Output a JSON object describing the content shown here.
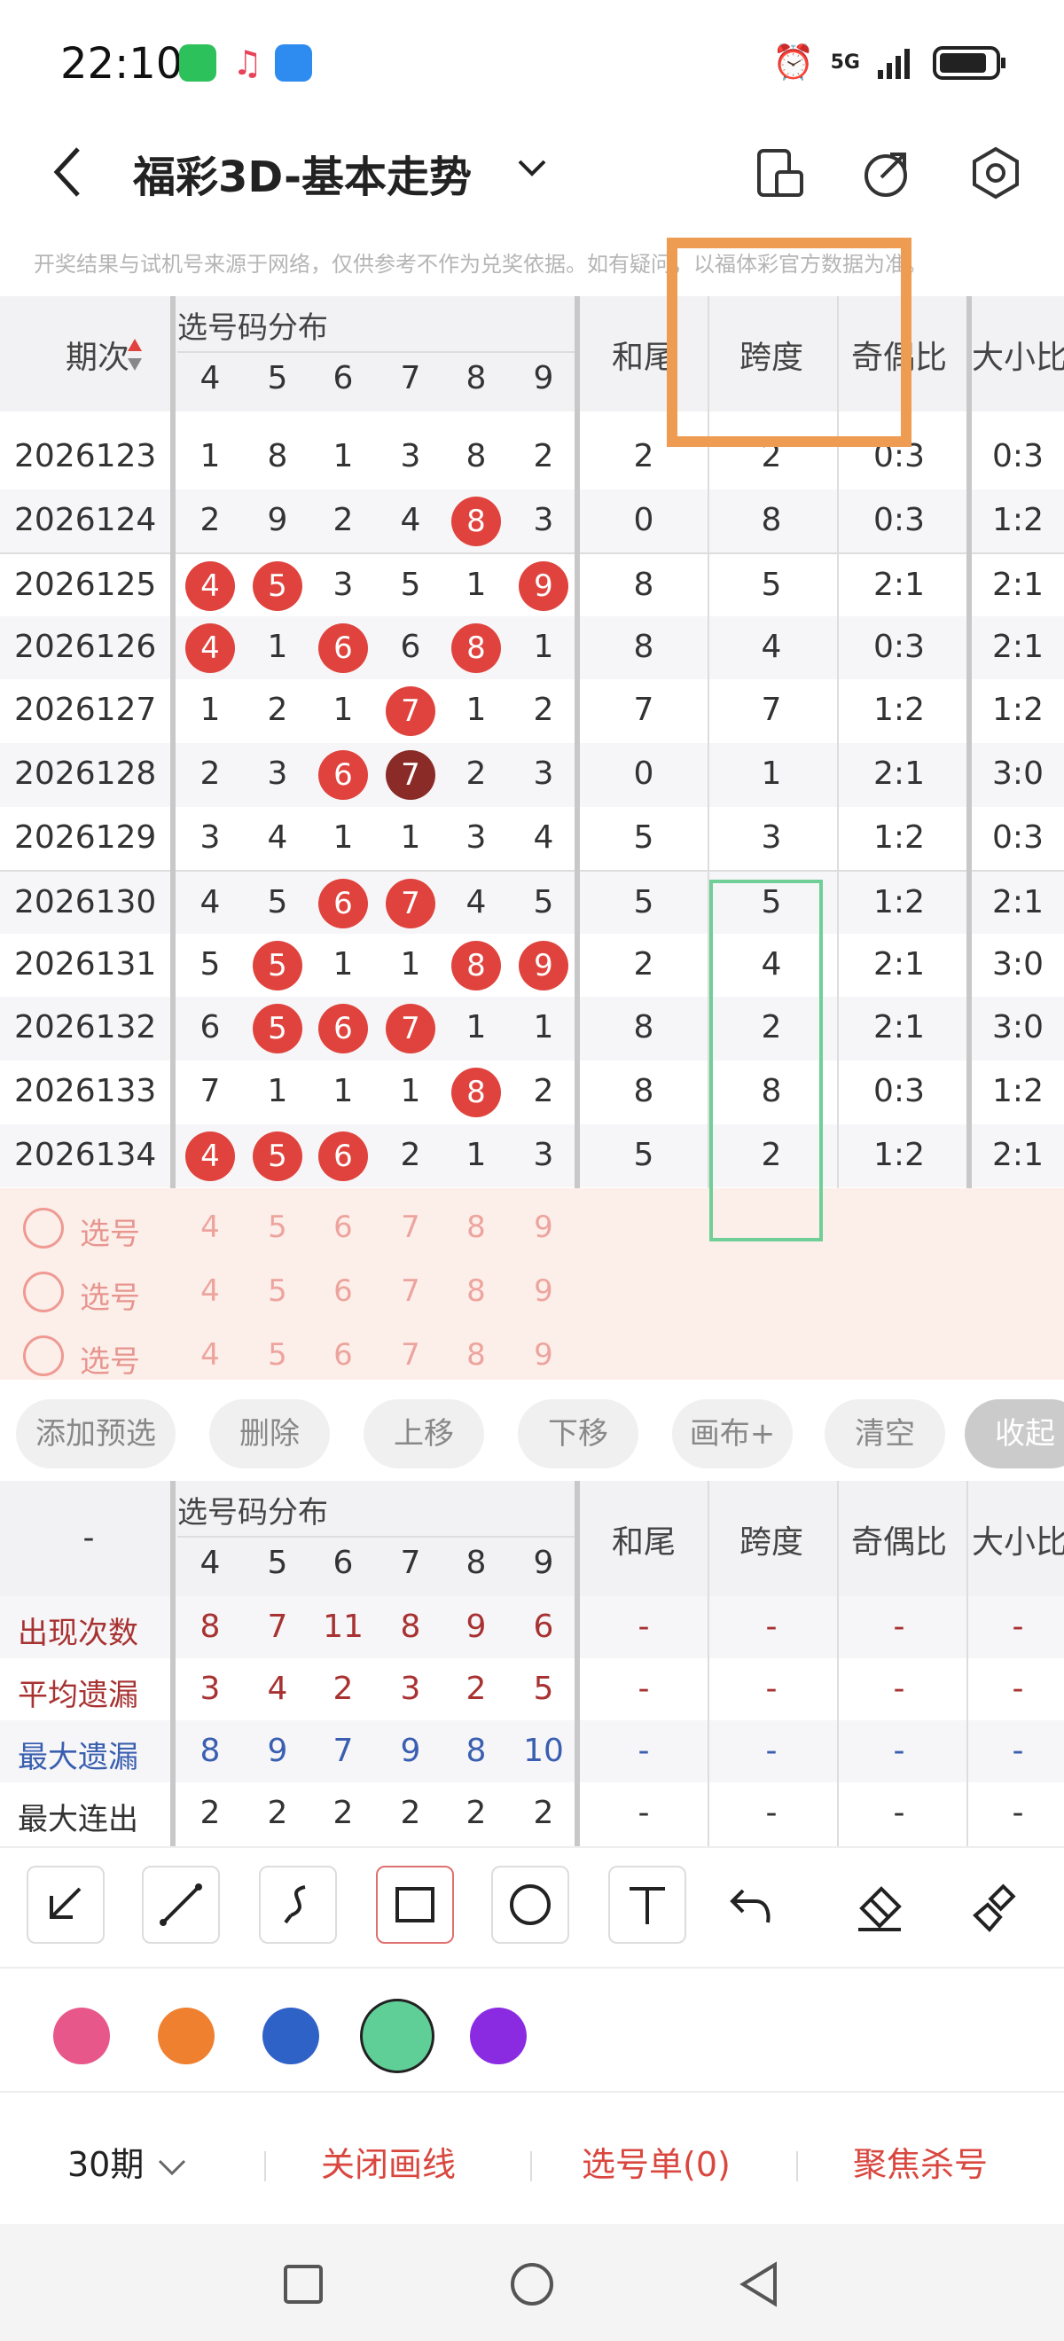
{
  "status_bar": {
    "time": "22:10",
    "network": "5G"
  },
  "header": {
    "title": "福彩3D-基本走势"
  },
  "notice": "开奖结果与试机号来源于网络，仅供参考不作为兑奖依据。如有疑问，以福体彩官方数据为准。",
  "table_header": {
    "period": "期次",
    "distribution": "选号码分布",
    "digits": [
      "4",
      "5",
      "6",
      "7",
      "8",
      "9"
    ],
    "col_hewei": "和尾",
    "col_kuadu": "跨度",
    "col_jiou": "奇偶比",
    "col_daxiao": "大小比"
  },
  "rows": [
    {
      "period": "2026123",
      "cells": [
        "1",
        "8",
        "1",
        "3",
        "8",
        "2"
      ],
      "hits": [],
      "hewei": "2",
      "kuadu": "2",
      "jiou": "0:3",
      "daxiao": "0:3"
    },
    {
      "period": "2026124",
      "cells": [
        "2",
        "9",
        "2",
        "4",
        "8",
        "3"
      ],
      "hits": [
        4
      ],
      "hewei": "0",
      "kuadu": "8",
      "jiou": "0:3",
      "daxiao": "1:2"
    },
    {
      "period": "2026125",
      "cells": [
        "4",
        "5",
        "3",
        "5",
        "1",
        "9"
      ],
      "hits": [
        0,
        1,
        5
      ],
      "hewei": "8",
      "kuadu": "5",
      "jiou": "2:1",
      "daxiao": "2:1"
    },
    {
      "period": "2026126",
      "cells": [
        "4",
        "1",
        "6",
        "6",
        "8",
        "1"
      ],
      "hits": [
        0,
        2,
        4
      ],
      "hewei": "8",
      "kuadu": "4",
      "jiou": "0:3",
      "daxiao": "2:1"
    },
    {
      "period": "2026127",
      "cells": [
        "1",
        "2",
        "1",
        "7",
        "1",
        "2"
      ],
      "hits": [
        3
      ],
      "hewei": "7",
      "kuadu": "7",
      "jiou": "1:2",
      "daxiao": "1:2"
    },
    {
      "period": "2026128",
      "cells": [
        "2",
        "3",
        "6",
        "7",
        "2",
        "3"
      ],
      "hits": [
        2,
        3
      ],
      "dark": [
        3
      ],
      "hewei": "0",
      "kuadu": "1",
      "jiou": "2:1",
      "daxiao": "3:0"
    },
    {
      "period": "2026129",
      "cells": [
        "3",
        "4",
        "1",
        "1",
        "3",
        "4"
      ],
      "hits": [],
      "hewei": "5",
      "kuadu": "3",
      "jiou": "1:2",
      "daxiao": "0:3"
    },
    {
      "period": "2026130",
      "cells": [
        "4",
        "5",
        "6",
        "7",
        "4",
        "5"
      ],
      "hits": [
        2,
        3
      ],
      "hewei": "5",
      "kuadu": "5",
      "jiou": "1:2",
      "daxiao": "2:1"
    },
    {
      "period": "2026131",
      "cells": [
        "5",
        "5",
        "1",
        "1",
        "8",
        "9"
      ],
      "hits": [
        1,
        4,
        5
      ],
      "hewei": "2",
      "kuadu": "4",
      "jiou": "2:1",
      "daxiao": "3:0"
    },
    {
      "period": "2026132",
      "cells": [
        "6",
        "5",
        "6",
        "7",
        "1",
        "1"
      ],
      "hits": [
        1,
        2,
        3
      ],
      "hewei": "8",
      "kuadu": "2",
      "jiou": "2:1",
      "daxiao": "3:0"
    },
    {
      "period": "2026133",
      "cells": [
        "7",
        "1",
        "1",
        "1",
        "8",
        "2"
      ],
      "hits": [
        4
      ],
      "hewei": "8",
      "kuadu": "8",
      "jiou": "0:3",
      "daxiao": "1:2"
    },
    {
      "period": "2026134",
      "cells": [
        "4",
        "5",
        "6",
        "2",
        "1",
        "3"
      ],
      "hits": [
        0,
        1,
        2
      ],
      "hewei": "5",
      "kuadu": "2",
      "jiou": "1:2",
      "daxiao": "2:1"
    }
  ],
  "pick_rows": {
    "label": "选号",
    "digits": [
      "4",
      "5",
      "6",
      "7",
      "8",
      "9"
    ]
  },
  "buttons": [
    "添加预选",
    "删除",
    "上移",
    "下移",
    "画布+",
    "清空",
    "收起"
  ],
  "stats_header": {
    "dash": "-",
    "distribution": "选号码分布",
    "digits": [
      "4",
      "5",
      "6",
      "7",
      "8",
      "9"
    ],
    "col_hewei": "和尾",
    "col_kuadu": "跨度",
    "col_jiou": "奇偶比",
    "col_daxiao": "大小比"
  },
  "stats": [
    {
      "label": "出现次数",
      "values": [
        "8",
        "7",
        "11",
        "8",
        "9",
        "6"
      ],
      "color": "#a83232"
    },
    {
      "label": "平均遗漏",
      "values": [
        "3",
        "4",
        "2",
        "3",
        "2",
        "5"
      ],
      "color": "#a83232"
    },
    {
      "label": "最大遗漏",
      "values": [
        "8",
        "9",
        "7",
        "9",
        "8",
        "10"
      ],
      "color": "#3a5fb0"
    },
    {
      "label": "最大连出",
      "values": [
        "2",
        "2",
        "2",
        "2",
        "2",
        "2"
      ],
      "color": "#333333"
    }
  ],
  "stats_dash": "-",
  "colors": [
    "#e8578a",
    "#ef8030",
    "#2f62c7",
    "#5fcf97",
    "#8a2be2"
  ],
  "bottom": {
    "periods": "30期",
    "close_lines": "关闭画线",
    "selection": "选号单(0)",
    "focus_kill": "聚焦杀号"
  }
}
